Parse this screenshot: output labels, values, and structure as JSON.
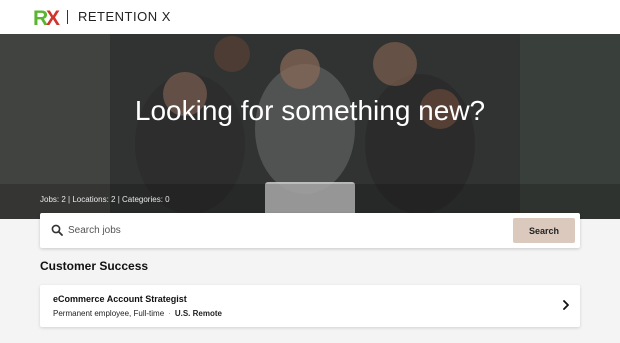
{
  "brand": {
    "logo_text": "RX",
    "name": "RETENTION X",
    "colors": {
      "logo_green": "#5bb531",
      "logo_red": "#d0342c"
    }
  },
  "hero": {
    "title": "Looking for something new?"
  },
  "stats": {
    "jobs": "Jobs: 2",
    "locations": "Locations: 2",
    "categories": "Categories: 0",
    "separator": " | "
  },
  "search": {
    "placeholder": "Search jobs",
    "button_label": "Search",
    "button_color": "#dcc9bd",
    "icon": "search-icon"
  },
  "section": {
    "title": "Customer Success"
  },
  "jobs": [
    {
      "title": "eCommerce Account Strategist",
      "employment": "Permanent employee, Full-time",
      "separator": "·",
      "location": "U.S. Remote",
      "icon": "chevron-right-icon"
    }
  ]
}
